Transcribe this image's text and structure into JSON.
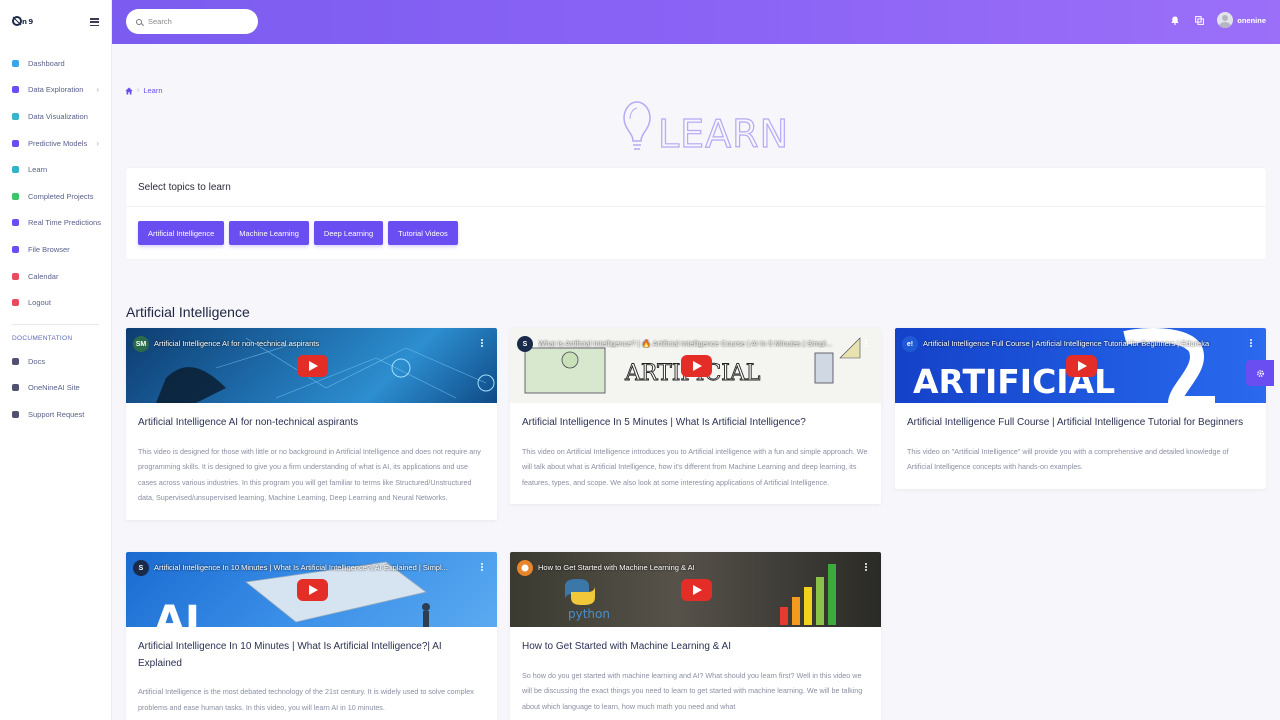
{
  "sidebar": {
    "logo": "onenine",
    "items": [
      {
        "label": "Dashboard",
        "icon": "dashboard-icon",
        "color": "#3aa6e8",
        "chevron": false
      },
      {
        "label": "Data Exploration",
        "icon": "compass-icon",
        "color": "#6a4ef2",
        "chevron": true
      },
      {
        "label": "Data Visualization",
        "icon": "chart-icon",
        "color": "#38b3c9",
        "chevron": false
      },
      {
        "label": "Predictive Models",
        "icon": "gear-icon",
        "color": "#6a4ef2",
        "chevron": true
      },
      {
        "label": "Learn",
        "icon": "graduation-cap-icon",
        "color": "#2fb5c7",
        "chevron": false
      },
      {
        "label": "Completed Projects",
        "icon": "check-icon",
        "color": "#3cc46a",
        "chevron": false
      },
      {
        "label": "Real Time Predictions",
        "icon": "settings-icon",
        "color": "#6a4ef2",
        "chevron": false
      },
      {
        "label": "File Browser",
        "icon": "file-icon",
        "color": "#6a4ef2",
        "chevron": false
      },
      {
        "label": "Calendar",
        "icon": "calendar-icon",
        "color": "#e84b5c",
        "chevron": false
      },
      {
        "label": "Logout",
        "icon": "logout-icon",
        "color": "#e84b5c",
        "chevron": false
      }
    ],
    "documentation_heading": "DOCUMENTATION",
    "doc_items": [
      {
        "label": "Docs",
        "icon": "book-icon",
        "color": "#505070"
      },
      {
        "label": "OneNineAI Site",
        "icon": "music-icon",
        "color": "#505070"
      },
      {
        "label": "Support Request",
        "icon": "support-icon",
        "color": "#505070"
      }
    ]
  },
  "topbar": {
    "search_placeholder": "Search",
    "username": "onenine"
  },
  "breadcrumb": {
    "current": "Learn"
  },
  "banner_text": "LEARN",
  "topics": {
    "heading": "Select topics to learn",
    "buttons": [
      "Artificial Intelligence",
      "Machine Learning",
      "Deep Learning",
      "Tutorial Videos"
    ]
  },
  "section_title": "Artificial Intelligence",
  "videos": [
    {
      "channel": "SM",
      "channel_color": "#2b6b4a",
      "video_title": "Artificial Intelligence AI for non-technical aspirants",
      "title": "Artificial Intelligence AI for non-technical aspirants",
      "description": "This video is designed for those with little or no background in Artificial Intelligence and does not require any programming skills. It is designed to give you a firm understanding of what is AI, its applications and use cases across various industries. In this program you will get familiar to terms like Structured/Unstructured data, Supervised/unsupervised learning, Machine Learning, Deep Learning and Neural Networks."
    },
    {
      "channel": "S",
      "channel_color": "#1a2a4a",
      "video_title": "What Is Artificial Intelligence? | 🔥 Artificial Intelligence Course | AI In 5 Minutes | Simpl...",
      "title": "Artificial Intelligence In 5 Minutes | What Is Artificial Intelligence?",
      "description": "This video on Artificial Intelligence introduces you to Artificial intelligence with a fun and simple approach. We will talk about what is Artificial Intelligence, how it's different from Machine Learning and deep learning, its features, types, and scope. We also look at some interesting applications of Artificial Intelligence."
    },
    {
      "channel": "e!",
      "channel_color": "#1f5ad6",
      "video_title": "Artificial Intelligence Full Course | Artificial Intelligence Tutorial for Beginners | Edureka",
      "title": "Artificial Intelligence Full Course | Artificial Intelligence Tutorial for Beginners",
      "description": "This video on \"Artificial Intelligence\" will provide you with a comprehensive and detailed knowledge of Artificial Intelligence concepts with hands-on examples."
    },
    {
      "channel": "S",
      "channel_color": "#1a2a4a",
      "video_title": "Artificial Intelligence In 10 Minutes | What Is Artificial Intelligence?| AI Explained | Simpl...",
      "title": "Artificial Intelligence In 10 Minutes | What Is Artificial Intelligence?| AI Explained",
      "description": "Artificial Intelligence is the most debated technology of the 21st century. It is widely used to solve complex problems and ease human tasks. In this video, you will learn AI in 10 minutes."
    },
    {
      "channel": "",
      "channel_color": "#e8852a",
      "video_title": "How to Get Started with Machine Learning & AI",
      "title": "How to Get Started with Machine Learning & AI",
      "description": "So how do you get started with machine learning and AI? What should you learn first? Well in this video we will be discussing the exact things you need to learn to get started with machine learning. We will be talking about which language to learn, how much math you need and what"
    }
  ],
  "thumb_texts": {
    "v2": "ARTIFICIAL",
    "v3": "ARTIFICIAL",
    "v4": "AI",
    "v5": "python"
  }
}
